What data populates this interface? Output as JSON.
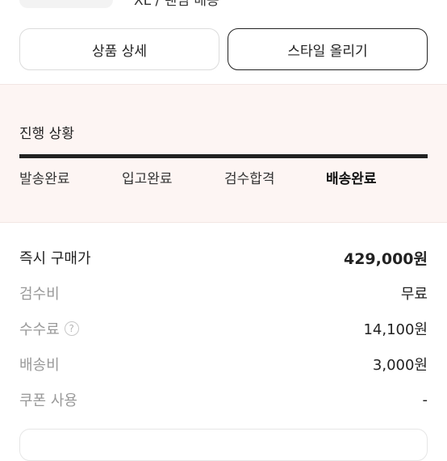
{
  "header": {
    "partial_text": "XL / 랜덤 배송"
  },
  "actions": {
    "detail_label": "상품 상세",
    "style_label": "스타일 올리기"
  },
  "progress": {
    "title": "진행 상황",
    "steps": [
      "발송완료",
      "입고완료",
      "검수합격",
      "배송완료"
    ],
    "current_step": "배송완료"
  },
  "price": {
    "rows": [
      {
        "label": "즉시 구매가",
        "value": "429,000원"
      },
      {
        "label": "검수비",
        "value": "무료"
      },
      {
        "label": "수수료",
        "value": "14,100원"
      },
      {
        "label": "배송비",
        "value": "3,000원"
      },
      {
        "label": "쿠폰 사용",
        "value": "-"
      }
    ]
  },
  "icons": {
    "help": "question-circle-icon"
  },
  "colors": {
    "progress_bg": "#fdf5f3",
    "bar": "#222222",
    "muted_text": "#999999"
  }
}
